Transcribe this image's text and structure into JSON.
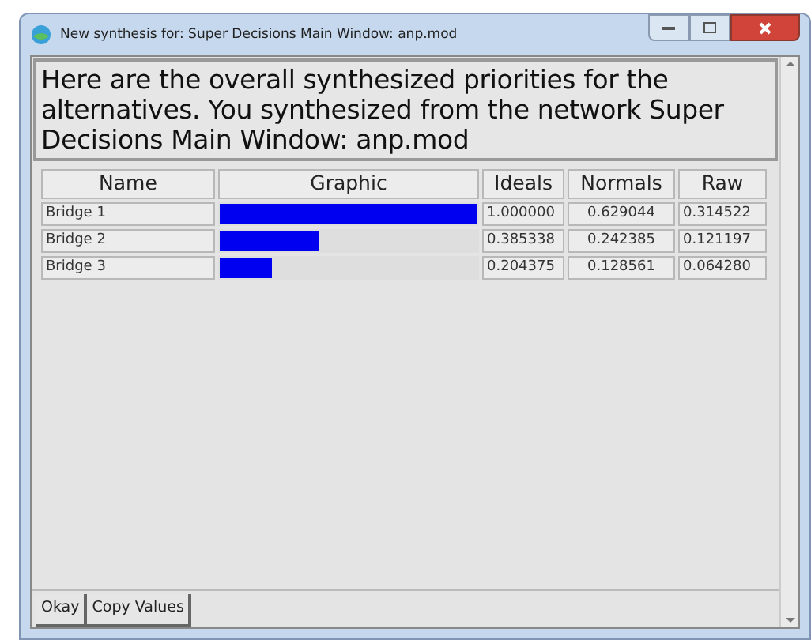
{
  "window": {
    "title": "New synthesis for: Super Decisions Main Window: anp.mod"
  },
  "message": "Here are the overall synthesized priorities for the alternatives.  You synthesized from the network Super Decisions Main Window: anp.mod",
  "table": {
    "columns": [
      "Name",
      "Graphic",
      "Ideals",
      "Normals",
      "Raw"
    ],
    "rows": [
      {
        "name": "Bridge 1",
        "level": 1.0,
        "ideals": "1.000000",
        "normals": "0.629044",
        "raw": "0.314522"
      },
      {
        "name": "Bridge 2",
        "level": 0.385338,
        "ideals": "0.385338",
        "normals": "0.242385",
        "raw": "0.121197"
      },
      {
        "name": "Bridge 3",
        "level": 0.204375,
        "ideals": "0.204375",
        "normals": "0.128561",
        "raw": "0.064280"
      }
    ]
  },
  "buttons": [
    "Okay",
    "Copy Values"
  ]
}
